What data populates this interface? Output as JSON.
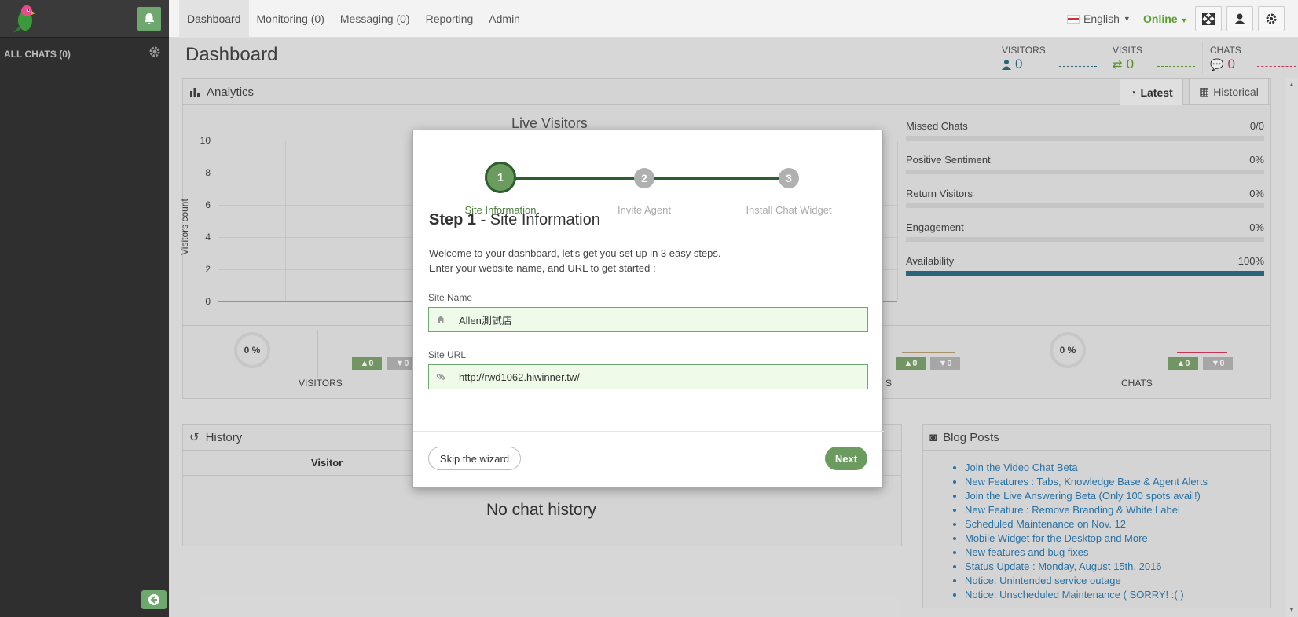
{
  "sidebar": {
    "all_chats": "ALL CHATS (0)"
  },
  "nav": {
    "items": [
      "Dashboard",
      "Monitoring (0)",
      "Messaging (0)",
      "Reporting",
      "Admin"
    ],
    "language": "English",
    "status": "Online"
  },
  "page": {
    "title": "Dashboard"
  },
  "stats": {
    "visitors_label": "VISITORS",
    "visitors_value": "0",
    "visitors_color": "#2f6c84",
    "visits_label": "VISITS",
    "visits_value": "0",
    "visits_color": "#5aa02c",
    "chats_label": "CHATS",
    "chats_value": "0",
    "chats_color": "#d33a5c"
  },
  "analytics": {
    "title": "Analytics",
    "tab_latest": "Latest",
    "tab_historical": "Historical",
    "chart_title": "Live Visitors",
    "y_label": "Visitors count",
    "y_ticks": [
      "10",
      "8",
      "6",
      "4",
      "2",
      "0"
    ],
    "metrics": [
      {
        "label": "Missed Chats",
        "value": "0/0",
        "fill": 0
      },
      {
        "label": "Positive Sentiment",
        "value": "0%",
        "fill": 0
      },
      {
        "label": "Return Visitors",
        "value": "0%",
        "fill": 0
      },
      {
        "label": "Engagement",
        "value": "0%",
        "fill": 0
      },
      {
        "label": "Availability",
        "value": "100%",
        "fill": 1
      }
    ],
    "gauge_visitors": "0 %",
    "gauge_chats": "0 %",
    "label_visitors": "VISITORS",
    "label_chats": "CHATS",
    "label_partial": "S",
    "badge_up": "▲0",
    "badge_down": "▼0"
  },
  "history": {
    "title": "History",
    "col_visitor": "Visitor",
    "empty": "No chat history"
  },
  "blog": {
    "title": "Blog Posts",
    "posts": [
      "Join the Video Chat Beta",
      "New Features : Tabs, Knowledge Base & Agent Alerts",
      "Join the Live Answering Beta (Only 100 spots avail!)",
      "New Feature : Remove Branding & White Label",
      "Scheduled Maintenance on Nov. 12",
      "Mobile Widget for the Desktop and More",
      "New features and bug fixes",
      "Status Update : Monday, August 15th, 2016",
      "Notice: Unintended service outage",
      "Notice: Unscheduled Maintenance ( SORRY! :( )"
    ]
  },
  "wizard": {
    "steps": [
      {
        "num": "1",
        "label": "Site Information"
      },
      {
        "num": "2",
        "label": "Invite Agent"
      },
      {
        "num": "3",
        "label": "Install Chat Widget"
      }
    ],
    "heading_step": "Step 1",
    "heading_rest": " - Site Information",
    "intro_line1": "Welcome to your dashboard, let's get you set up in 3 easy steps.",
    "intro_line2": "Enter your website name, and URL to get started :",
    "site_name_label": "Site Name",
    "site_name_value": "Allen測試店",
    "site_url_label": "Site URL",
    "site_url_value": "http://rwd1062.hiwinner.tw/",
    "skip_label": "Skip the wizard",
    "next_label": "Next"
  }
}
